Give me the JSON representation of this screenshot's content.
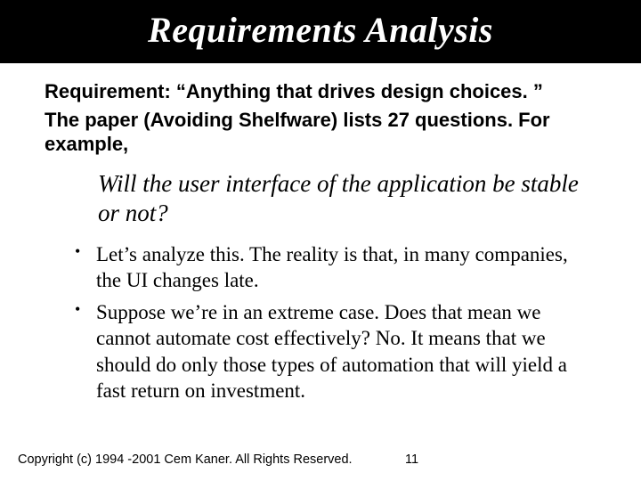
{
  "title": "Requirements Analysis",
  "body": {
    "lead1": "Requirement: “Anything that drives design choices. ”",
    "lead2": "The paper (Avoiding Shelfware) lists 27 questions. For example,",
    "quote": "Will the user interface of the application be stable or not?",
    "bullets": [
      "Let’s analyze this. The reality is that, in many companies, the UI changes late.",
      "Suppose we’re in an extreme case. Does that mean we cannot automate cost effectively? No. It means that we should do only those types of automation that will yield a fast return on investment."
    ]
  },
  "footer": {
    "copyright": "Copyright (c) 1994 -2001 Cem Kaner. All Rights Reserved.",
    "page": "11"
  }
}
